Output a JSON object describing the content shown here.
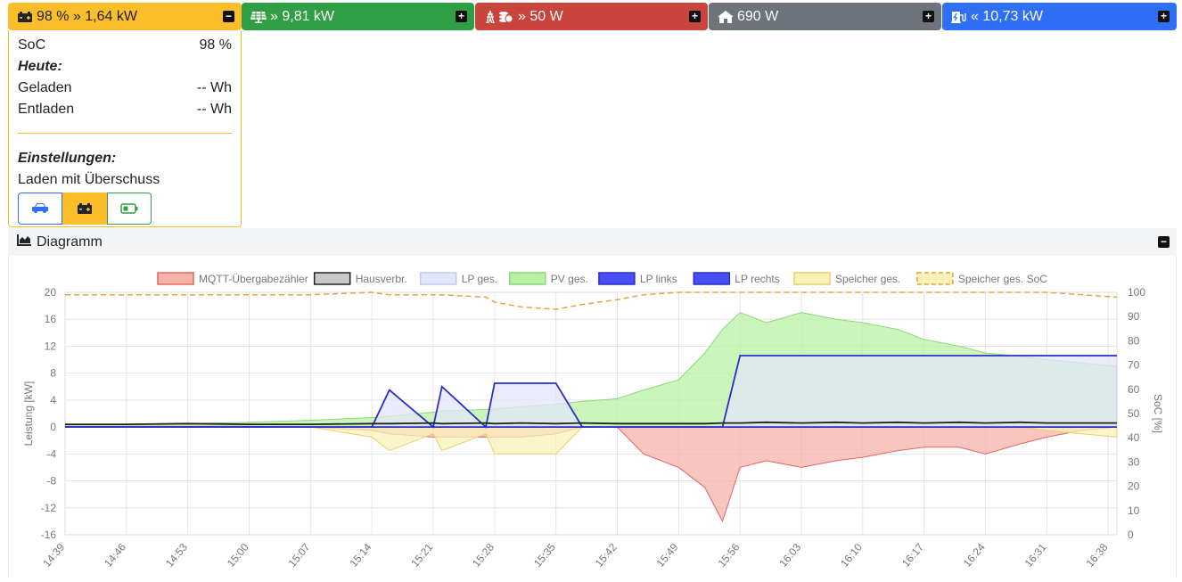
{
  "cards": {
    "battery": {
      "value": "98 % » 1,64 kW",
      "icon": "battery-icon"
    },
    "pv": {
      "value": "» 9,81 kW",
      "icon": "solar-panel-icon"
    },
    "grid": {
      "value": "» 50 W",
      "icon": "power-tower-coins-icon"
    },
    "house": {
      "value": "690 W",
      "icon": "house-icon"
    },
    "ev": {
      "value": "« 10,73 kW",
      "icon": "charging-station-icon"
    }
  },
  "battery_panel": {
    "soc_label": "SoC",
    "soc_value": "98 %",
    "today_heading": "Heute:",
    "charged_label": "Geladen",
    "charged_value": "-- Wh",
    "discharged_label": "Entladen",
    "discharged_value": "-- Wh",
    "settings_heading": "Einstellungen:",
    "mode_label": "Laden mit Überschuss",
    "mode_buttons": [
      "car-icon",
      "battery-icon",
      "battery-low-icon"
    ],
    "active_mode": "battery"
  },
  "diagram": {
    "title": "Diagramm"
  },
  "colors": {
    "battery": "#fbbd2a",
    "pv": "#2f9e44",
    "grid": "#c9443d",
    "house": "#6c737b",
    "ev": "#2f6ff5"
  },
  "chart_data": {
    "type": "area",
    "ylabel": "Leistung [kW]",
    "y2label": "SoC [%]",
    "ylim": [
      -16,
      20
    ],
    "y2lim": [
      0,
      100
    ],
    "yticks": [
      20,
      16,
      12,
      8,
      4,
      0,
      -4,
      -8,
      -12,
      -16
    ],
    "y2ticks": [
      100,
      90,
      80,
      70,
      60,
      50,
      40,
      30,
      20,
      10,
      0
    ],
    "x_ticks": [
      "14:39",
      "14:46",
      "14:53",
      "15:00",
      "15:07",
      "15:14",
      "15:21",
      "15:28",
      "15:35",
      "15:42",
      "15:49",
      "15:56",
      "16:03",
      "16:10",
      "16:17",
      "16:24",
      "16:31",
      "16:38"
    ],
    "x": [
      "14:39",
      "14:46",
      "14:53",
      "15:00",
      "15:07",
      "15:14",
      "15:16",
      "15:21",
      "15:22",
      "15:27",
      "15:28",
      "15:31",
      "15:35",
      "15:38",
      "15:42",
      "15:45",
      "15:49",
      "15:52",
      "15:54",
      "15:56",
      "15:59",
      "16:03",
      "16:07",
      "16:10",
      "16:14",
      "16:17",
      "16:21",
      "16:24",
      "16:28",
      "16:31",
      "16:35",
      "16:39"
    ],
    "legend": [
      {
        "name": "MQTT-Übergabezähler",
        "fill": "#f6b3aa",
        "stroke": "#e06666"
      },
      {
        "name": "Hausverbr.",
        "fill": "#c8c8c8",
        "stroke": "#222222"
      },
      {
        "name": "LP ges.",
        "fill": "#e3e5fa",
        "stroke": "#c5c8f2"
      },
      {
        "name": "PV ges.",
        "fill": "#b9f2a4",
        "stroke": "#8ad97a"
      },
      {
        "name": "LP links",
        "fill": "#4a4ff5",
        "stroke": "#2a2fc7"
      },
      {
        "name": "LP rechts",
        "fill": "#4a4ff5",
        "stroke": "#2a2fc7"
      },
      {
        "name": "Speicher ges.",
        "fill": "#f8f2b8",
        "stroke": "#e8cf6a"
      },
      {
        "name": "Speicher ges. SoC",
        "fill": "#f8f2b8",
        "stroke": "#e8a33a",
        "dashed": true
      }
    ],
    "series": [
      {
        "name": "PV ges.",
        "values": [
          0.3,
          0.4,
          0.5,
          0.7,
          1.0,
          1.4,
          1.6,
          2.2,
          2.4,
          2.6,
          2.7,
          3.0,
          3.4,
          3.8,
          4.2,
          5.5,
          7.0,
          11.0,
          14.5,
          17.0,
          15.5,
          17.0,
          16.0,
          15.5,
          14.5,
          13.0,
          12.0,
          11.0,
          10.5,
          10.0,
          9.5,
          9.0
        ]
      },
      {
        "name": "MQTT-Übergabezähler",
        "values": [
          0.1,
          0.1,
          0.1,
          0.1,
          0.0,
          -0.5,
          -1.0,
          -1.5,
          -1.5,
          -1.5,
          -1.5,
          -1.5,
          -1.0,
          0.0,
          0.0,
          -4.0,
          -6.0,
          -9.0,
          -14.0,
          -6.0,
          -5.0,
          -6.0,
          -5.0,
          -4.5,
          -3.5,
          -3.0,
          -3.0,
          -4.0,
          -2.5,
          -1.5,
          -0.5,
          0.0
        ]
      },
      {
        "name": "Hausverbr.",
        "values": [
          0.4,
          0.4,
          0.5,
          0.4,
          0.4,
          0.5,
          0.5,
          0.6,
          0.5,
          0.6,
          0.5,
          0.6,
          0.5,
          0.6,
          0.5,
          0.5,
          0.5,
          0.5,
          0.6,
          0.6,
          0.7,
          0.6,
          0.7,
          0.6,
          0.7,
          0.6,
          0.7,
          0.6,
          0.7,
          0.6,
          0.6,
          0.6
        ]
      },
      {
        "name": "LP ges.",
        "values": [
          0,
          0,
          0,
          0,
          0,
          0,
          5.5,
          0,
          6.0,
          0,
          6.5,
          6.5,
          6.5,
          0,
          0,
          0,
          0,
          0,
          0,
          10.6,
          10.6,
          10.6,
          10.6,
          10.6,
          10.6,
          10.6,
          10.6,
          10.6,
          10.6,
          10.6,
          10.6,
          10.6
        ]
      },
      {
        "name": "LP links",
        "values": [
          0,
          0,
          0,
          0,
          0,
          0,
          5.5,
          0,
          6.0,
          0,
          6.5,
          6.5,
          6.5,
          0,
          0,
          0,
          0,
          0,
          0,
          10.6,
          10.6,
          10.6,
          10.6,
          10.6,
          10.6,
          10.6,
          10.6,
          10.6,
          10.6,
          10.6,
          10.6,
          10.6
        ]
      },
      {
        "name": "LP rechts",
        "values": [
          0,
          0,
          0,
          0,
          0,
          0,
          0,
          0,
          0,
          0,
          0,
          0,
          0,
          0,
          0,
          0,
          0,
          0,
          0,
          0,
          0,
          0,
          0,
          0,
          0,
          0,
          0,
          0,
          0,
          0,
          0,
          0
        ]
      },
      {
        "name": "Speicher ges.",
        "values": [
          0,
          0,
          0,
          0,
          0,
          -1.5,
          -3.5,
          -1.0,
          -3.5,
          -1.0,
          -4.0,
          -4.0,
          -4.0,
          0,
          0,
          0,
          0,
          0,
          0,
          0,
          0,
          0,
          0,
          0,
          0,
          0,
          0,
          0,
          0,
          -0.5,
          -1.0,
          -1.5
        ]
      },
      {
        "name": "Speicher ges. SoC",
        "axis": "right",
        "values": [
          99,
          99,
          99,
          99,
          99,
          100,
          99,
          99,
          99,
          98,
          96,
          94,
          93,
          95,
          97,
          99,
          100,
          100,
          100,
          100,
          100,
          100,
          100,
          100,
          100,
          100,
          100,
          100,
          100,
          100,
          99,
          98
        ]
      }
    ]
  }
}
